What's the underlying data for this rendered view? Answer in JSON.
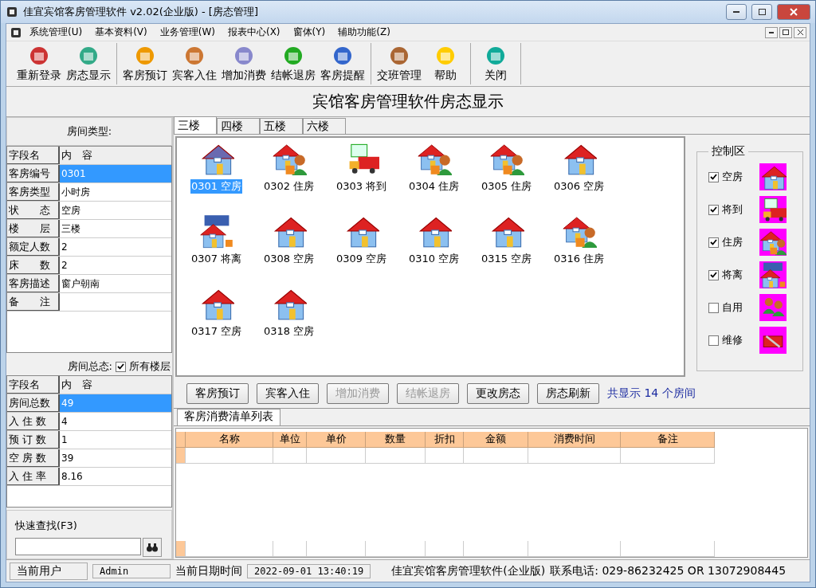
{
  "window": {
    "title": "佳宜宾馆客房管理软件 v2.02(企业版)  - [房态管理]"
  },
  "menu": [
    "系统管理(U)",
    "基本资料(V)",
    "业务管理(W)",
    "报表中心(X)",
    "窗体(Y)",
    "辅助功能(Z)"
  ],
  "toolbar": [
    [
      "重新登录",
      "房态显示"
    ],
    [
      "客房预订",
      "宾客入住",
      "增加消费",
      "结帐退房",
      "客房提醒"
    ],
    [
      "交班管理",
      "帮助"
    ],
    [
      "关闭"
    ]
  ],
  "header": "宾馆客房管理软件房态显示",
  "room_info": {
    "title": "房间类型:",
    "columns": [
      "字段名",
      "内　容"
    ],
    "rows": [
      {
        "field": "客房编号",
        "value": "0301",
        "selected": true
      },
      {
        "field": "客房类型",
        "value": "小时房",
        "selected": false
      },
      {
        "field": "状　　态",
        "value": "空房",
        "selected": false
      },
      {
        "field": "楼　　层",
        "value": "三楼",
        "selected": false
      },
      {
        "field": "额定人数",
        "value": "2",
        "selected": false
      },
      {
        "field": "床　　数",
        "value": "2",
        "selected": false
      },
      {
        "field": "客房描述",
        "value": "窗户朝南",
        "selected": false
      },
      {
        "field": "备　　注",
        "selected": false
      }
    ]
  },
  "room_summary": {
    "title": "房间总态:",
    "all_floors": {
      "label": "所有楼层",
      "checked": true
    },
    "columns": [
      "字段名",
      "内　容"
    ],
    "rows": [
      {
        "field": "房间总数",
        "value": "49",
        "selected": true
      },
      {
        "field": "入 住 数",
        "value": "4",
        "selected": false
      },
      {
        "field": "预 订 数",
        "value": "1",
        "selected": false
      },
      {
        "field": "空 房 数",
        "value": "39",
        "selected": false
      },
      {
        "field": "入 住 率",
        "value": "8.16",
        "selected": false
      }
    ]
  },
  "quick_search": {
    "label": "快速查找(F3)"
  },
  "floor_tabs": [
    {
      "label": "三楼",
      "selected": true
    },
    {
      "label": "四楼",
      "selected": false
    },
    {
      "label": "五楼",
      "selected": false
    },
    {
      "label": "六楼",
      "selected": false
    }
  ],
  "rooms": [
    {
      "label": "0301 空房",
      "kind": "vacant",
      "selected": true
    },
    {
      "label": "0302 住房",
      "kind": "occupied",
      "selected": false
    },
    {
      "label": "0303 将到",
      "kind": "arriving",
      "selected": false
    },
    {
      "label": "0304 住房",
      "kind": "occupied",
      "selected": false
    },
    {
      "label": "0305 住房",
      "kind": "occupied",
      "selected": false
    },
    {
      "label": "0306 空房",
      "kind": "vacant",
      "selected": false
    },
    {
      "label": "0307 将离",
      "kind": "leaving",
      "selected": false
    },
    {
      "label": "0308 空房",
      "kind": "vacant",
      "selected": false
    },
    {
      "label": "0309 空房",
      "kind": "vacant",
      "selected": false
    },
    {
      "label": "0310 空房",
      "kind": "vacant",
      "selected": false
    },
    {
      "label": "0315 空房",
      "kind": "vacant",
      "selected": false
    },
    {
      "label": "0316 住房",
      "kind": "occupied",
      "selected": false
    },
    {
      "label": "0317 空房",
      "kind": "vacant",
      "selected": false
    },
    {
      "label": "0318 空房",
      "kind": "vacant",
      "selected": false
    }
  ],
  "control_panel": {
    "title": "控制区",
    "filters": [
      {
        "label": "空房",
        "kind": "vacant",
        "checked": true
      },
      {
        "label": "将到",
        "kind": "arriving",
        "checked": true
      },
      {
        "label": "住房",
        "kind": "occupied",
        "checked": true
      },
      {
        "label": "将离",
        "kind": "leaving",
        "checked": true
      },
      {
        "label": "自用",
        "kind": "self_use",
        "checked": false
      },
      {
        "label": "维修",
        "kind": "repair",
        "checked": false
      }
    ]
  },
  "actions": [
    {
      "label": "客房预订",
      "disabled": false
    },
    {
      "label": "宾客入住",
      "disabled": false
    },
    {
      "label": "增加消费",
      "disabled": true
    },
    {
      "label": "结帐退房",
      "disabled": true
    },
    {
      "label": "更改房态",
      "disabled": false
    },
    {
      "label": "房态刷新",
      "disabled": false
    }
  ],
  "room_count": "共显示 14 个房间",
  "consumption": {
    "tab": "客房消费清单列表",
    "columns": [
      "名称",
      "单位",
      "单价",
      "数量",
      "折扣",
      "金额",
      "消费时间",
      "备注"
    ]
  },
  "status_bar": {
    "user_label": "当前用户",
    "user": "Admin",
    "time_label": "当前日期时间",
    "time": "2022-09-01 13:40:19",
    "product": "佳宜宾馆客房管理软件(企业版)",
    "contact": "联系电话: 029-86232425  OR  13072908445"
  }
}
